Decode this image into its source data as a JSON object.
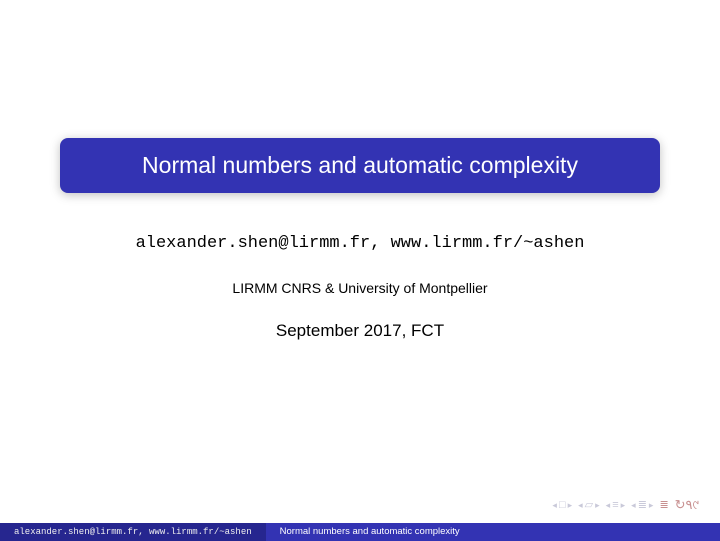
{
  "title": "Normal numbers and automatic complexity",
  "author": "alexander.shen@lirmm.fr, www.lirmm.fr/~ashen",
  "institute": "LIRMM CNRS & University of Montpellier",
  "date": "September 2017, FCT",
  "footer": {
    "left": "alexander.shen@lirmm.fr, www.lirmm.fr/~ashen",
    "right": "Normal numbers and automatic complexity"
  }
}
